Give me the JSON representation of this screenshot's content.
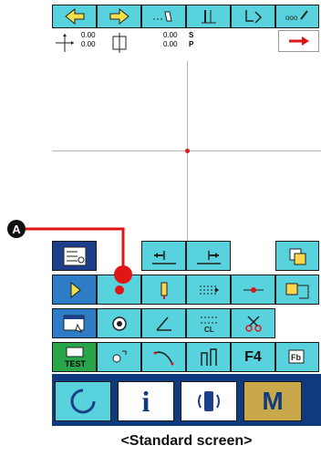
{
  "toolbar": {
    "buttons": [
      "arrow-left-icon",
      "arrow-right-icon",
      "pen-icon",
      "needle-icon",
      "feed-icon",
      "pattern-edit-icon"
    ]
  },
  "info_bar": {
    "pos_x": "0.00",
    "pos_y": "0.00",
    "size_x": "0.00",
    "size_y": "0.00",
    "label_s": "S",
    "label_p": "P"
  },
  "grid": {
    "buttons": [
      "list-icon",
      "back-arrow-icon",
      "forward-arrow-icon",
      "",
      "",
      "copy-icon",
      "cursor-icon",
      "pointer-icon",
      "feed-icon",
      "range-icon",
      "tension-icon",
      "sewing-machine-icon",
      "window-icon",
      "thread-icon",
      "angle-icon",
      "cl-icon",
      "scissors-icon",
      "",
      "test-icon",
      "offset-icon",
      "curve-icon",
      "setting-icon",
      "F4",
      "fb-icon"
    ]
  },
  "bottom": {
    "power_label": "",
    "info_label": "i",
    "comm_label": "",
    "mode_label": "M"
  },
  "callout": {
    "label": "A"
  },
  "caption": "<Standard screen>",
  "colors": {
    "teal": "#58d3dd",
    "blue": "#2e7cc6",
    "navy": "#1d3f8a",
    "green": "#29a64a",
    "red": "#e01616",
    "bottom": "#0f3b7e",
    "mode": "#c8a84a"
  }
}
